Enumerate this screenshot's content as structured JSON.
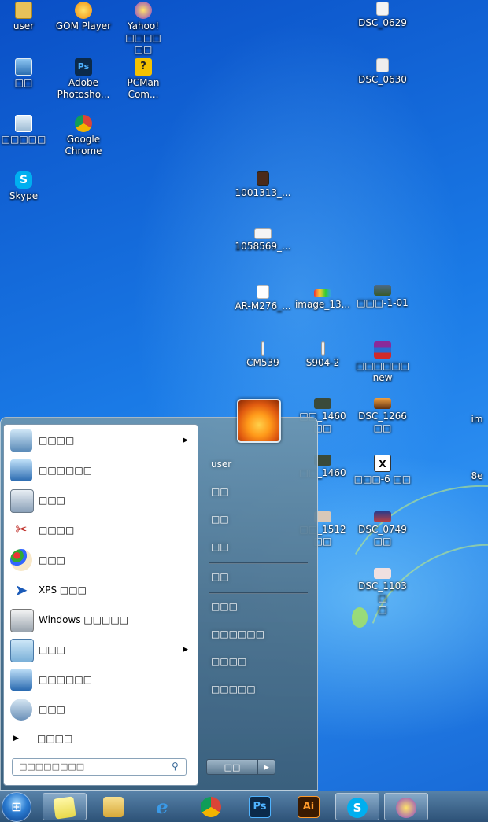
{
  "desktop": {
    "icons": [
      {
        "label": "user",
        "icon": "folder-icon"
      },
      {
        "label": "GOM Player",
        "icon": "gom-player-icon"
      },
      {
        "label": "Yahoo!□□□□\n□□",
        "icon": "yahoo-messenger-icon"
      },
      {
        "label": "DSC_0629",
        "icon": "image-file-icon"
      },
      {
        "label": "□□",
        "icon": "computer-icon"
      },
      {
        "label": "Adobe\nPhotosho...",
        "icon": "photoshop-icon"
      },
      {
        "label": "PCMan\nCom...",
        "icon": "pcman-icon"
      },
      {
        "label": "DSC_0630",
        "icon": "image-file-icon"
      },
      {
        "label": "□□□□□",
        "icon": "recycle-bin-icon"
      },
      {
        "label": "Google\nChrome",
        "icon": "chrome-icon"
      },
      {
        "label": "Skype",
        "icon": "skype-icon"
      },
      {
        "label": "1001313_...",
        "icon": "image-file-icon"
      },
      {
        "label": "1058569_...",
        "icon": "image-file-icon"
      },
      {
        "label": "AR-M276_...",
        "icon": "image-file-icon"
      },
      {
        "label": "image_13...",
        "icon": "image-file-icon"
      },
      {
        "label": "□□□-1-01",
        "icon": "image-file-icon"
      },
      {
        "label": "CM539",
        "icon": "image-file-icon"
      },
      {
        "label": "S904-2",
        "icon": "image-file-icon"
      },
      {
        "label": "□□□□□□\nnew",
        "icon": "winrar-icon"
      },
      {
        "label": "□□_1460\n□□",
        "icon": "image-file-icon"
      },
      {
        "label": "DSC_1266\n□□",
        "icon": "image-file-icon"
      },
      {
        "label": "im",
        "icon": "image-file-icon"
      },
      {
        "label": "□□_1460",
        "icon": "image-file-icon"
      },
      {
        "label": "□□□-6 □□",
        "icon": "image-file-icon"
      },
      {
        "label": "8e",
        "icon": "image-file-icon"
      },
      {
        "label": "□□_1512\n□□",
        "icon": "image-file-icon"
      },
      {
        "label": "DSC_0749\n□□",
        "icon": "image-file-icon"
      },
      {
        "label": "DSC_1103 □\n□",
        "icon": "image-file-icon"
      }
    ]
  },
  "start_menu": {
    "programs": [
      {
        "label": "□□□□",
        "icon": "getting-started-icon",
        "has_submenu": true
      },
      {
        "label": "□□□□□□",
        "icon": "remote-desktop-icon",
        "has_submenu": false
      },
      {
        "label": "□□□",
        "icon": "calculator-icon",
        "has_submenu": false
      },
      {
        "label": "□□□□",
        "icon": "snipping-tool-icon",
        "has_submenu": false
      },
      {
        "label": "□□□",
        "icon": "paint-icon",
        "has_submenu": false
      },
      {
        "label": "XPS □□□",
        "icon": "xps-viewer-icon",
        "has_submenu": false
      },
      {
        "label": "Windows □□□□□",
        "icon": "fax-scan-icon",
        "has_submenu": false
      },
      {
        "label": "□□□",
        "icon": "notepad-icon",
        "has_submenu": true
      },
      {
        "label": "□□□□□□",
        "icon": "remote-connection-icon",
        "has_submenu": false
      },
      {
        "label": "□□□",
        "icon": "magnifier-icon",
        "has_submenu": false
      }
    ],
    "all_programs_label": "□□□□",
    "search_placeholder": "□□□□□□□□",
    "right_items": [
      {
        "label": "user"
      },
      {
        "label": "□□"
      },
      {
        "label": "□□"
      },
      {
        "label": "□□"
      },
      {
        "label": "□□"
      },
      {
        "label": "□□□"
      },
      {
        "label": "□□□□□□"
      },
      {
        "label": "□□□□"
      },
      {
        "label": "□□□□□"
      }
    ],
    "shutdown_label": "□□"
  },
  "taskbar": {
    "apps": [
      {
        "name": "sticky-notes",
        "icon": "sticky-notes-icon",
        "active": true
      },
      {
        "name": "explorer",
        "icon": "folder-icon",
        "active": false
      },
      {
        "name": "internet-explorer",
        "icon": "ie-icon",
        "active": false
      },
      {
        "name": "chrome",
        "icon": "chrome-icon",
        "active": false
      },
      {
        "name": "photoshop",
        "icon": "photoshop-icon",
        "text": "Ps",
        "active": false
      },
      {
        "name": "illustrator",
        "icon": "illustrator-icon",
        "text": "Ai",
        "active": false
      },
      {
        "name": "skype",
        "icon": "skype-icon",
        "text": "S",
        "active": true
      },
      {
        "name": "yahoo-messenger",
        "icon": "yahoo-messenger-icon",
        "active": true
      }
    ]
  },
  "colors": {
    "desktop_blue": "#1a7ae6",
    "taskbar": "#2d5073",
    "start_menu_glass": "#5a7f9a"
  }
}
